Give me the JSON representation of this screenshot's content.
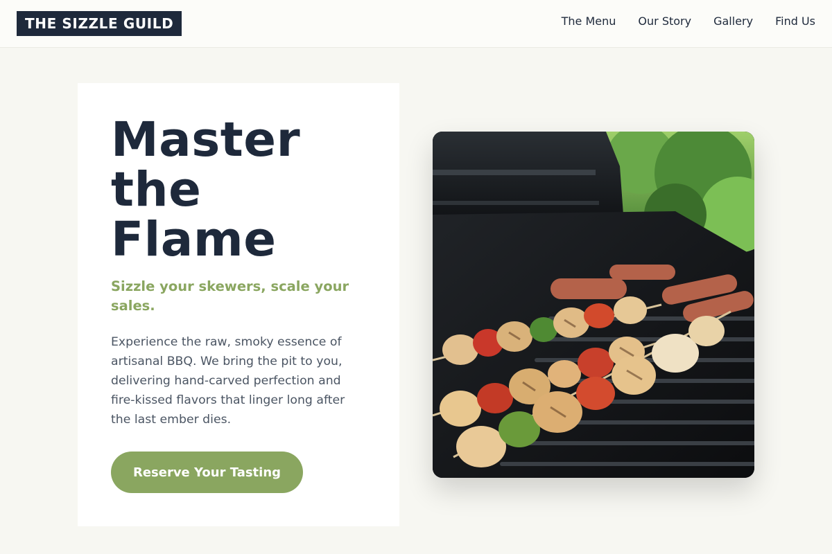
{
  "header": {
    "logo": "THE SIZZLE GUILD",
    "nav": [
      "The Menu",
      "Our Story",
      "Gallery",
      "Find Us"
    ]
  },
  "hero": {
    "title_lines": [
      "Master",
      "the",
      "Flame"
    ],
    "subtitle": "Sizzle your skewers, scale your sales.",
    "description": "Experience the raw, smoky essence of artisanal BBQ. We bring the pit to you, delivering hand-carved perfection and fire-kissed flavors that linger long after the last ember dies.",
    "cta": "Reserve Your Tasting",
    "image": "grilled-skewers-photo"
  },
  "colors": {
    "navy": "#1e293b",
    "accent_green": "#8aa660",
    "background": "#f7f7f2",
    "body_text": "#4b5563"
  }
}
